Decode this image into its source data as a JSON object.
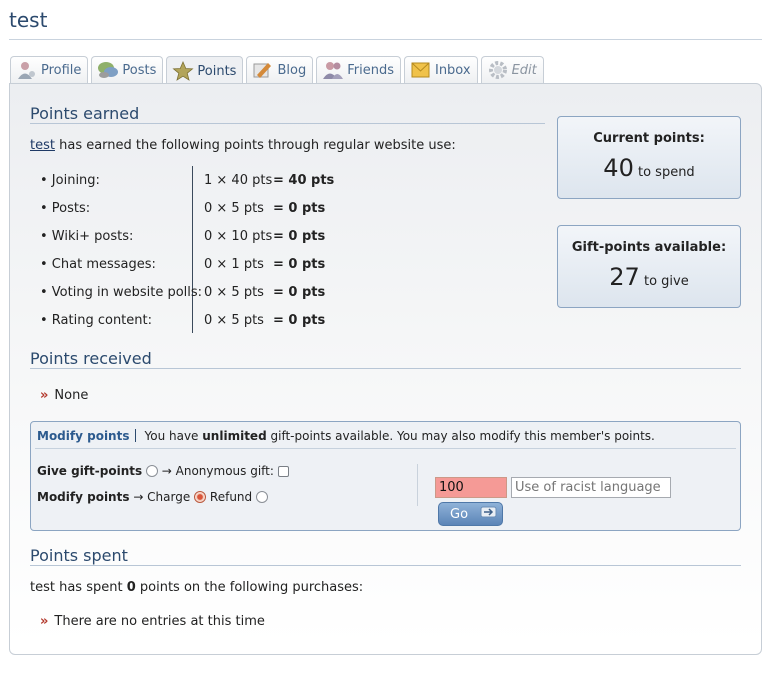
{
  "page": {
    "title": "test"
  },
  "tabs": [
    {
      "label": "Profile",
      "icon": "profile-icon"
    },
    {
      "label": "Posts",
      "icon": "posts-icon"
    },
    {
      "label": "Points",
      "icon": "star-icon",
      "active": true
    },
    {
      "label": "Blog",
      "icon": "blog-icon"
    },
    {
      "label": "Friends",
      "icon": "friends-icon"
    },
    {
      "label": "Inbox",
      "icon": "inbox-icon"
    },
    {
      "label": "Edit",
      "icon": "gear-icon"
    }
  ],
  "earned": {
    "heading": "Points earned",
    "username": "test",
    "intro": "has earned the following points through regular website use:",
    "rows": [
      {
        "label": "• Joining:",
        "mult": "1 × 40 pts",
        "total": "= 40 pts"
      },
      {
        "label": "• Posts:",
        "mult": "0 × 5 pts",
        "total": "= 0 pts"
      },
      {
        "label": "• Wiki+ posts:",
        "mult": "0 × 10 pts",
        "total": "= 0 pts"
      },
      {
        "label": "• Chat messages:",
        "mult": "0 × 1 pts",
        "total": "= 0 pts"
      },
      {
        "label": "• Voting in website polls:",
        "mult": "0 × 5 pts",
        "total": "= 0 pts"
      },
      {
        "label": "• Rating content:",
        "mult": "0 × 5 pts",
        "total": "= 0 pts"
      }
    ]
  },
  "current_points": {
    "heading": "Current points:",
    "value": "40",
    "suffix": "to spend"
  },
  "gift_points": {
    "heading": "Gift-points available:",
    "value": "27",
    "suffix": "to give"
  },
  "received": {
    "heading": "Points received",
    "item": "None"
  },
  "modify": {
    "title": "Modify points",
    "notice_pre": "You have",
    "notice_bold": "unlimited",
    "notice_post": "gift-points available. You may also modify this member's points.",
    "give_label": "Give gift-points",
    "anon_label": "→ Anonymous gift:",
    "modify_label": "Modify points",
    "charge_label": "→ Charge",
    "refund_label": "Refund",
    "amount_value": "100",
    "reason_placeholder": "Use of racist language",
    "go_label": "Go"
  },
  "spent": {
    "heading": "Points spent",
    "text_pre": "test has spent",
    "text_bold": "0",
    "text_post": "points on the following purchases:",
    "item": "There are no entries at this time"
  }
}
